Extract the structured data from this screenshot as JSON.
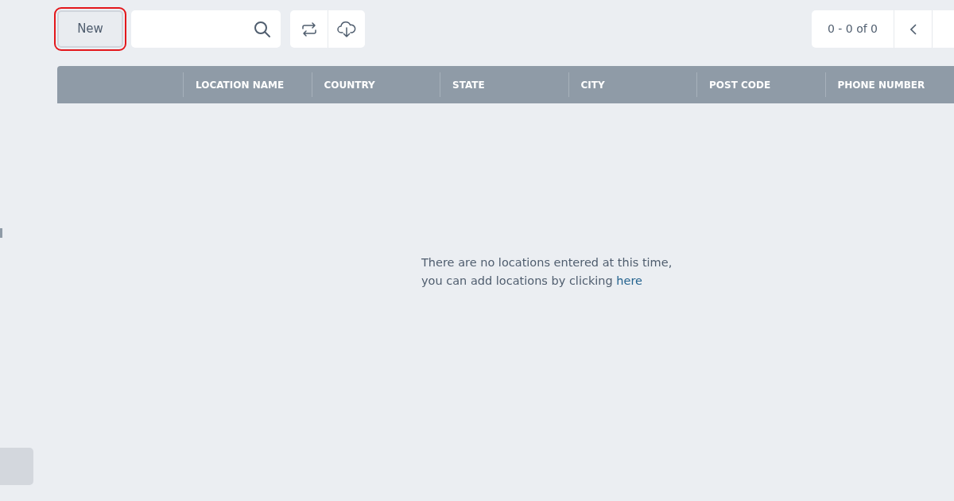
{
  "toolbar": {
    "new_button": {
      "label": "New",
      "highlighted": true
    }
  },
  "pager": {
    "range": "0 - 0 of 0"
  },
  "table": {
    "columns": [
      "LOCATION NAME",
      "COUNTRY",
      "STATE",
      "CITY",
      "POST CODE",
      "PHONE NUMBER"
    ]
  },
  "empty_message": {
    "line_1": "There are no locations entered at this time,",
    "line_2": "you can add locations by clicking",
    "link": "here"
  }
}
